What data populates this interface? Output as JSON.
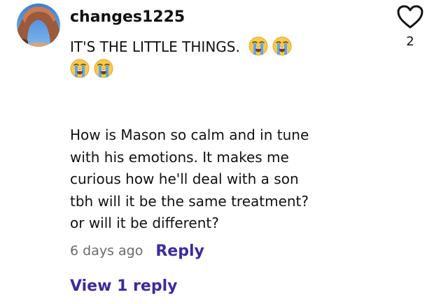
{
  "comment": {
    "username": "changes1225",
    "lines": [
      "IT'S THE LITTLE THINGS.",
      "How is Mason so calm and in tune",
      "with his emotions. It makes me",
      "curious how he'll deal with a son",
      "tbh will it be the same treatment?",
      "or will it be different?"
    ],
    "emoji_name": "loudly-crying-face",
    "emoji_count": 4,
    "timestamp": "6 days ago",
    "reply_label": "Reply",
    "view_replies_label": "View 1 reply",
    "like_count": "2"
  },
  "colors": {
    "text": "#111111",
    "muted": "#6b6b6b",
    "accent": "#3b2c9e"
  },
  "icons": {
    "like": "heart-outline-icon",
    "avatar": "avatar"
  }
}
